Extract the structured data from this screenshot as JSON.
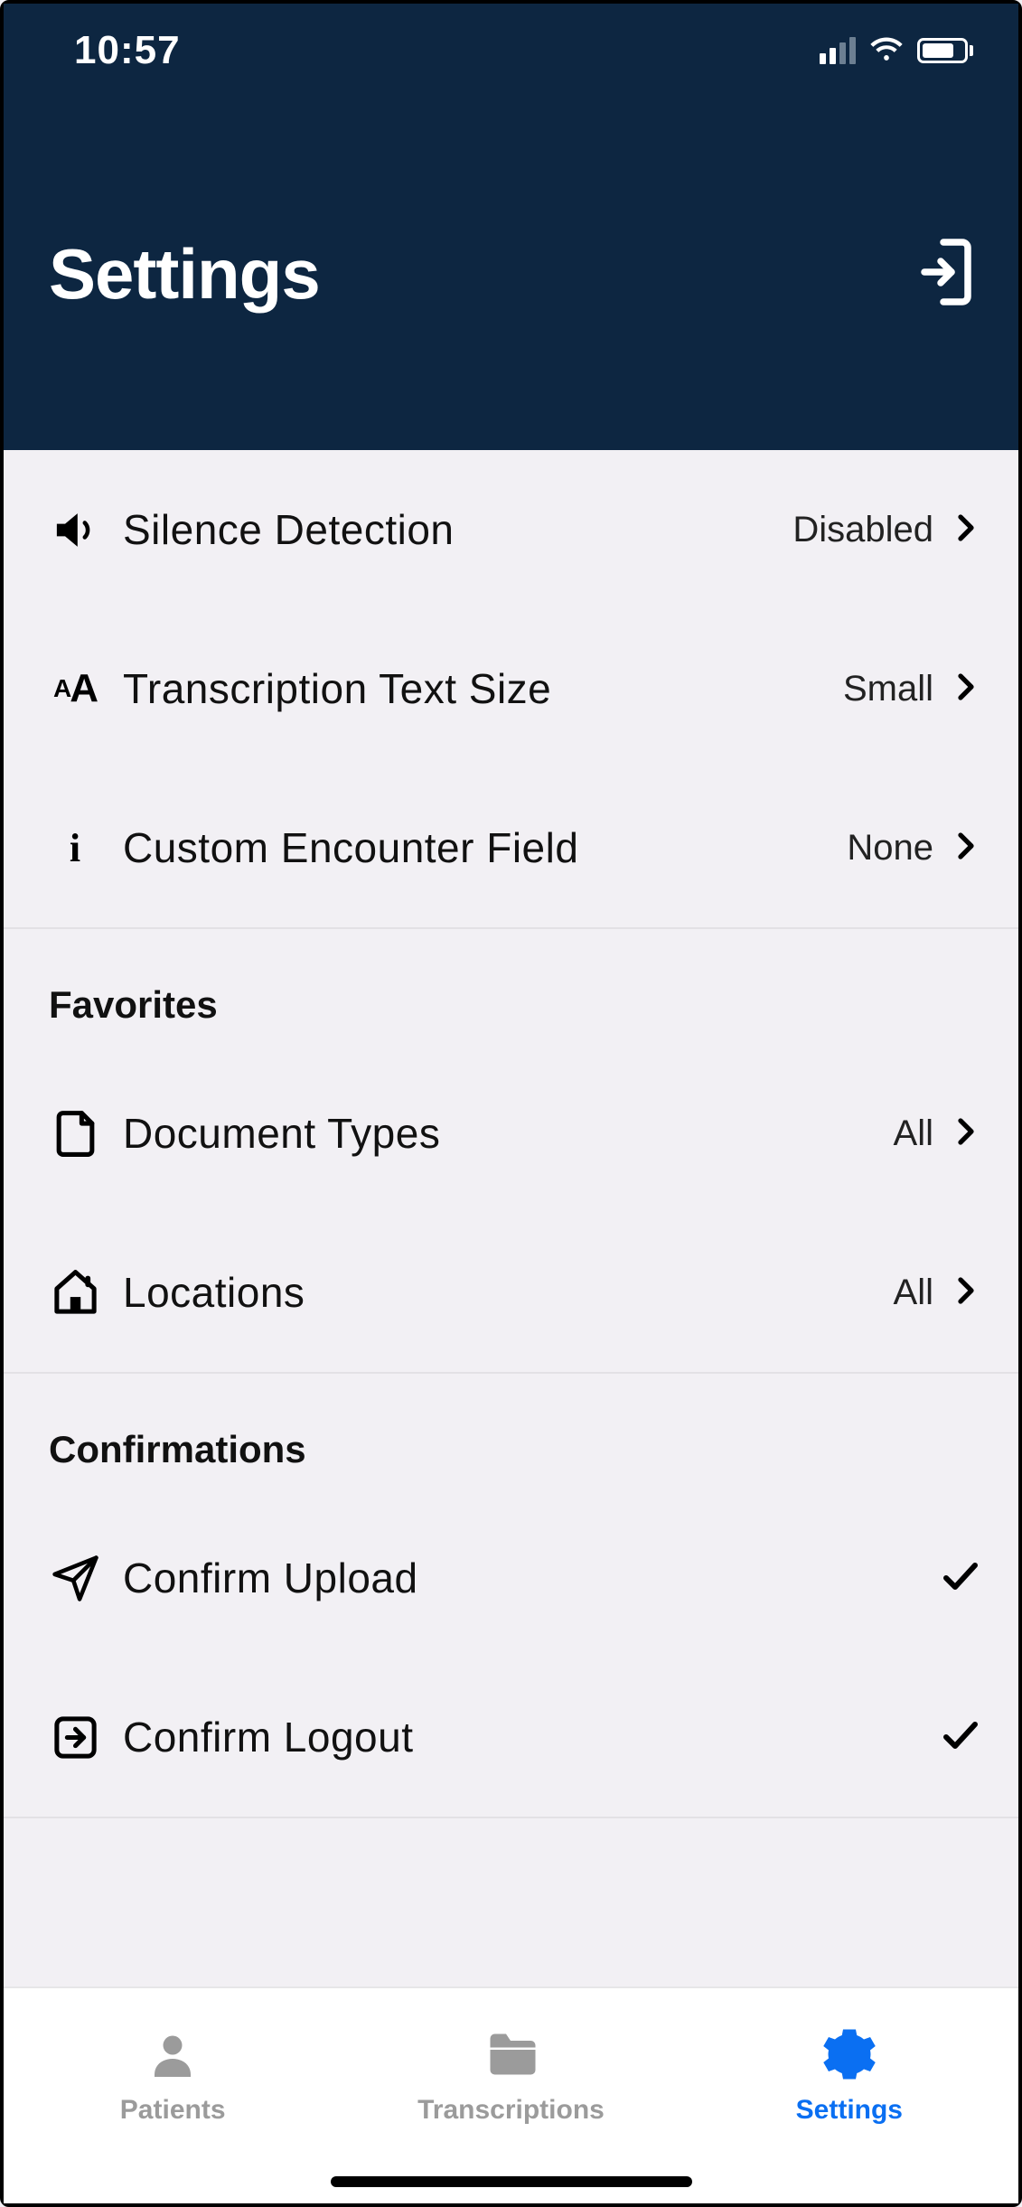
{
  "status": {
    "time": "10:57"
  },
  "header": {
    "title": "Settings"
  },
  "sections": {
    "general": {
      "silence_detection": {
        "label": "Silence Detection",
        "value": "Disabled"
      },
      "text_size": {
        "label": "Transcription Text Size",
        "value": "Small"
      },
      "custom_field": {
        "label": "Custom Encounter Field",
        "value": "None"
      }
    },
    "favorites": {
      "title": "Favorites",
      "doc_types": {
        "label": "Document Types",
        "value": "All"
      },
      "locations": {
        "label": "Locations",
        "value": "All"
      }
    },
    "confirmations": {
      "title": "Confirmations",
      "upload": {
        "label": "Confirm Upload",
        "checked": true
      },
      "logout": {
        "label": "Confirm Logout",
        "checked": true
      }
    }
  },
  "tabs": {
    "patients": "Patients",
    "transcriptions": "Transcriptions",
    "settings": "Settings"
  }
}
